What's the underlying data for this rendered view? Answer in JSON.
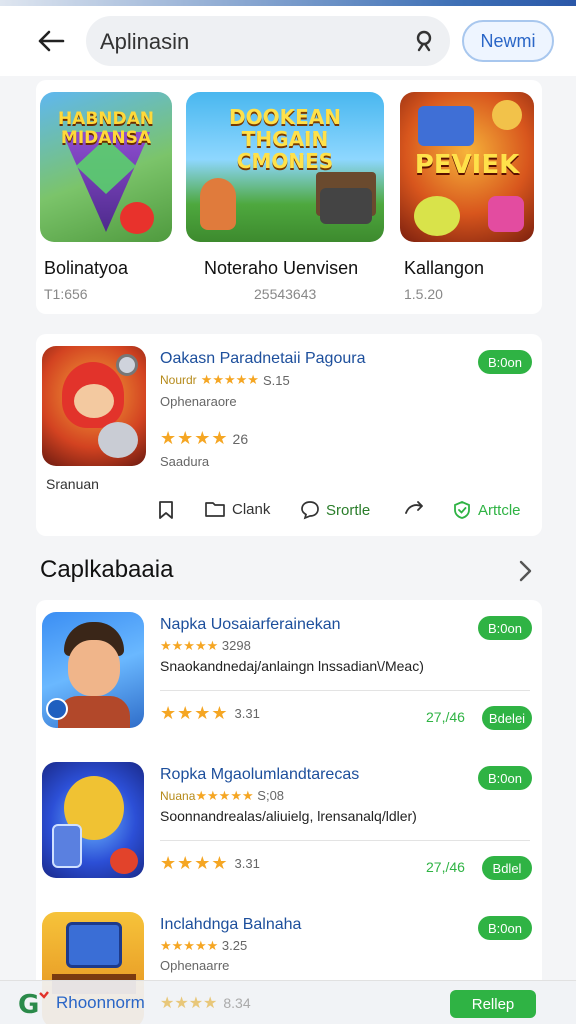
{
  "header": {
    "search_value": "Aplinasin",
    "new_button": "Newmi"
  },
  "featured": [
    {
      "art_title": "HABNDAN MIDANSA",
      "name": "Bolinatyoa",
      "count": "T1:656"
    },
    {
      "art_title": "DOOKEAN THGAIN CMONES",
      "name": "Noteraho Uenvisen",
      "count": "25543643"
    },
    {
      "art_title": "PEVIEK",
      "name": "Kallangon",
      "count": "1.5.20"
    }
  ],
  "highlight": {
    "title": "Oakasn Paradnetaii Pagoura",
    "stars_small": "★★★★★",
    "stars_text": "Nourdr",
    "rating_small": "S.15",
    "category": "Ophenaraore",
    "stars_large": "★★★★",
    "rating_large": "26",
    "tag": "Saadura",
    "subtitle": "Sranuan",
    "badge": "B:0on",
    "actions": [
      "Clank",
      "Srortle",
      "Arttcle"
    ]
  },
  "section": {
    "title": "Caplkabaaia"
  },
  "apps": [
    {
      "title": "Napka Uosaiarferainekan",
      "stars_small": "★★★★★",
      "rating_small": "3298",
      "desc": "Snaokandnedaj/anlaingn lnssadian\\/Meac)",
      "stars_large": "★★★★",
      "rating_large": "3.31",
      "price": "27,/46",
      "badge_top": "B:0on",
      "badge_bottom": "Bdelei"
    },
    {
      "title": "Ropka Mgaolumlandtarecas",
      "stars_small": "★★★★★",
      "stars_text": "Nuana",
      "rating_small": "S;08",
      "desc": "Soonnandrealas/aliuielg, lrensanalq/ldler)",
      "stars_large": "★★★★",
      "rating_large": "3.31",
      "price": "27,/46",
      "badge_top": "B:0on",
      "badge_bottom": "Bdlel"
    },
    {
      "title": "Inclahdnga Balnaha",
      "stars_small": "★★★★★",
      "rating_small": "3.25",
      "desc": "Ophenaarre",
      "badge_top": "B:0on"
    }
  ],
  "bottom": {
    "label": "Rhoonnorm",
    "stars": "★★★★",
    "rating": "8.34",
    "button": "Rellep"
  },
  "colors": {
    "accent_green": "#2fb344",
    "title_blue": "#1d4f9c",
    "star_yellow": "#f5a623"
  }
}
